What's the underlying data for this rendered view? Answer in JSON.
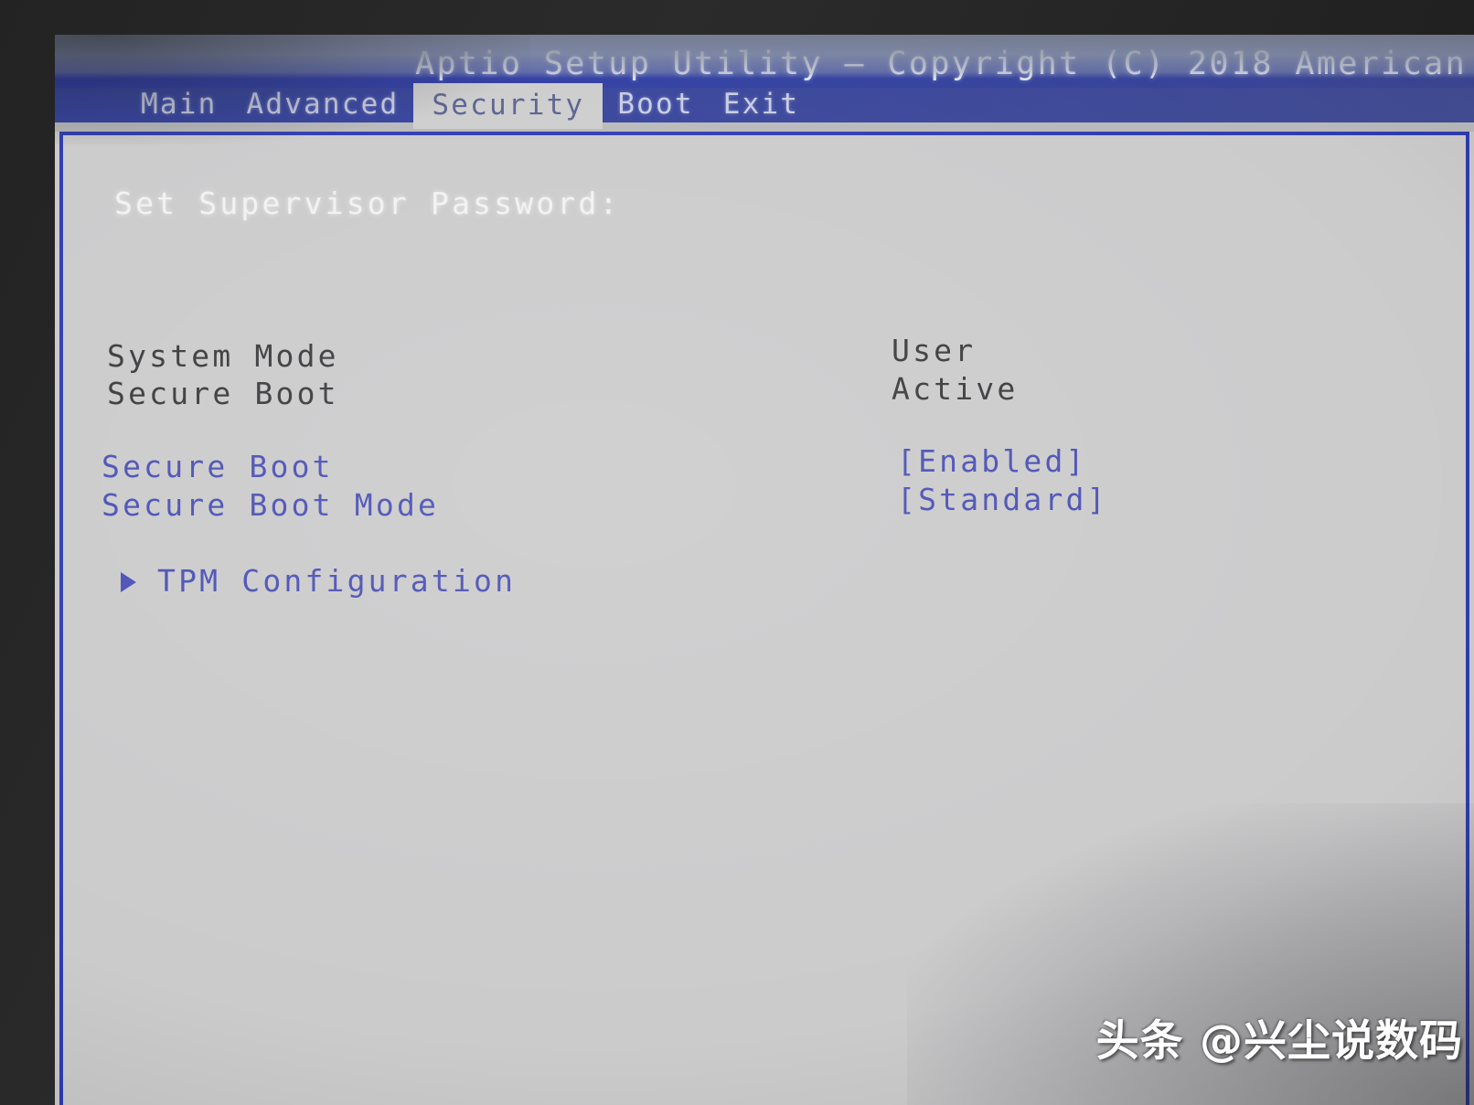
{
  "window": {
    "title": "Aptio Setup Utility – Copyright (C) 2018 American"
  },
  "menubar": {
    "items": [
      {
        "label": "Main",
        "selected": false
      },
      {
        "label": "Advanced",
        "selected": false
      },
      {
        "label": "Security",
        "selected": true
      },
      {
        "label": "Boot",
        "selected": false
      },
      {
        "label": "Exit",
        "selected": false
      }
    ]
  },
  "main": {
    "supervisor_password_label": "Set Supervisor Password:",
    "items": [
      {
        "label": "System Mode",
        "value": "User",
        "type": "readonly"
      },
      {
        "label": "Secure Boot",
        "value": "Active",
        "type": "readonly"
      },
      {
        "label": "Secure Boot",
        "value": "[Enabled]",
        "type": "option"
      },
      {
        "label": "Secure Boot Mode",
        "value": "[Standard]",
        "type": "option"
      }
    ],
    "submenu": {
      "arrow_icon": "triangle-right-icon",
      "label": "TPM Configuration"
    }
  },
  "watermark": {
    "text": "头条 @兴尘说数码"
  },
  "colors": {
    "titlebar_blue": "#2c39a8",
    "panel_gray": "#cbcbcc",
    "border_blue": "#2f3cae",
    "option_blue": "#4a50b4",
    "readonly_dark": "#3a3a3c",
    "header_text": "#e2e4ee",
    "bezel": "#232323"
  }
}
